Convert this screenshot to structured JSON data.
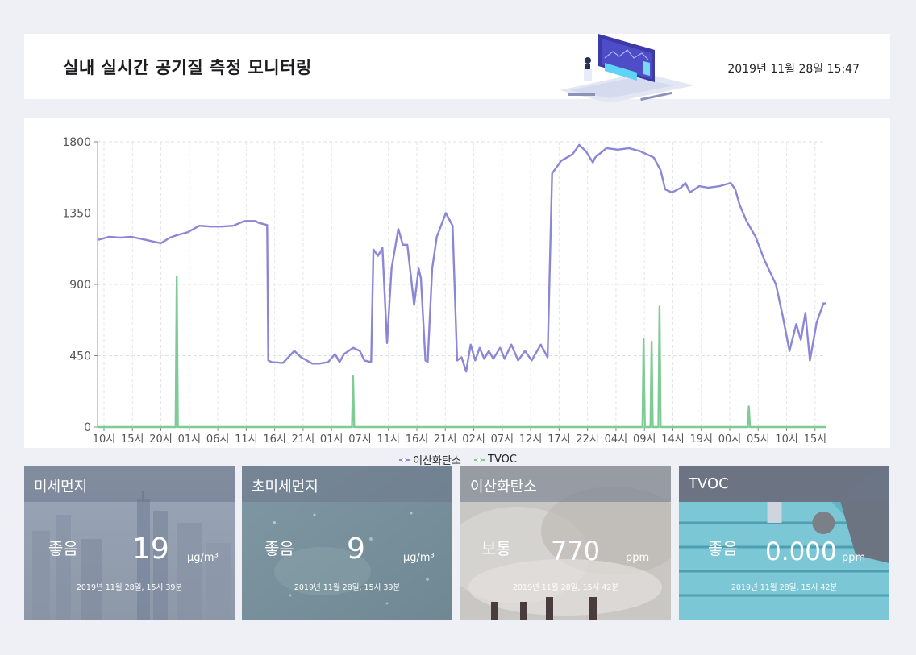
{
  "header": {
    "title": "실내 실시간 공기질 측정 모니터링",
    "datetime": "2019년 11월 28일 15:47"
  },
  "chart_data": {
    "type": "line",
    "ylim": [
      0,
      1800
    ],
    "yticks": [
      0,
      450,
      900,
      1350,
      1800
    ],
    "x_labels": [
      "10시",
      "15시",
      "20시",
      "01시",
      "06시",
      "11시",
      "16시",
      "21시",
      "01시",
      "07시",
      "11시",
      "16시",
      "21시",
      "02시",
      "07시",
      "12시",
      "17시",
      "22시",
      "04시",
      "09시",
      "14시",
      "19시",
      "00시",
      "05시",
      "10시",
      "15시"
    ],
    "x_range": [
      0,
      26
    ],
    "series": [
      {
        "name": "이산화탄소",
        "color": "#8b86d6",
        "points": [
          [
            0,
            1180
          ],
          [
            0.5,
            1200
          ],
          [
            1,
            1195
          ],
          [
            1.5,
            1200
          ],
          [
            2,
            1185
          ],
          [
            2.8,
            1160
          ],
          [
            3.2,
            1195
          ],
          [
            3.5,
            1210
          ],
          [
            4,
            1230
          ],
          [
            4.5,
            1270
          ],
          [
            5,
            1265
          ],
          [
            5.5,
            1265
          ],
          [
            6,
            1270
          ],
          [
            6.5,
            1300
          ],
          [
            7,
            1300
          ],
          [
            7.1,
            1290
          ],
          [
            7.5,
            1275
          ],
          [
            7.55,
            420
          ],
          [
            7.7,
            410
          ],
          [
            8.2,
            405
          ],
          [
            8.5,
            450
          ],
          [
            8.7,
            480
          ],
          [
            9,
            440
          ],
          [
            9.5,
            400
          ],
          [
            9.8,
            400
          ],
          [
            10.2,
            410
          ],
          [
            10.5,
            460
          ],
          [
            10.7,
            410
          ],
          [
            10.9,
            460
          ],
          [
            11.3,
            500
          ],
          [
            11.6,
            480
          ],
          [
            11.8,
            420
          ],
          [
            12.1,
            410
          ],
          [
            12.2,
            1120
          ],
          [
            12.4,
            1080
          ],
          [
            12.6,
            1130
          ],
          [
            12.8,
            530
          ],
          [
            13,
            1000
          ],
          [
            13.3,
            1250
          ],
          [
            13.5,
            1150
          ],
          [
            13.7,
            1150
          ],
          [
            14,
            770
          ],
          [
            14.2,
            1000
          ],
          [
            14.3,
            940
          ],
          [
            14.5,
            420
          ],
          [
            14.6,
            410
          ],
          [
            14.8,
            1000
          ],
          [
            15,
            1200
          ],
          [
            15.4,
            1350
          ],
          [
            15.7,
            1270
          ],
          [
            15.9,
            420
          ],
          [
            16.1,
            440
          ],
          [
            16.3,
            350
          ],
          [
            16.5,
            520
          ],
          [
            16.7,
            420
          ],
          [
            16.9,
            500
          ],
          [
            17.1,
            430
          ],
          [
            17.3,
            480
          ],
          [
            17.5,
            430
          ],
          [
            17.8,
            500
          ],
          [
            18,
            430
          ],
          [
            18.3,
            520
          ],
          [
            18.6,
            420
          ],
          [
            18.9,
            480
          ],
          [
            19.2,
            420
          ],
          [
            19.6,
            520
          ],
          [
            19.9,
            440
          ],
          [
            20.1,
            1600
          ],
          [
            20.5,
            1680
          ],
          [
            21,
            1720
          ],
          [
            21.3,
            1780
          ],
          [
            21.6,
            1740
          ],
          [
            21.9,
            1670
          ],
          [
            22,
            1700
          ],
          [
            22.5,
            1760
          ],
          [
            23,
            1750
          ],
          [
            23.5,
            1760
          ],
          [
            24,
            1740
          ],
          [
            24.3,
            1720
          ],
          [
            24.6,
            1700
          ],
          [
            24.9,
            1620
          ],
          [
            25.1,
            1500
          ],
          [
            25.4,
            1480
          ],
          [
            25.8,
            1510
          ],
          [
            26,
            1540
          ],
          [
            26.2,
            1480
          ],
          [
            26.6,
            1520
          ],
          [
            27,
            1510
          ],
          [
            27.5,
            1520
          ],
          [
            28,
            1540
          ],
          [
            28.2,
            1500
          ],
          [
            28.4,
            1400
          ],
          [
            28.7,
            1300
          ],
          [
            29.1,
            1200
          ],
          [
            29.5,
            1050
          ],
          [
            30,
            900
          ],
          [
            30.3,
            700
          ],
          [
            30.6,
            480
          ],
          [
            30.9,
            650
          ],
          [
            31.1,
            550
          ],
          [
            31.3,
            720
          ],
          [
            31.5,
            420
          ],
          [
            31.8,
            660
          ],
          [
            32.1,
            780
          ],
          [
            32.2,
            780
          ]
        ]
      },
      {
        "name": "TVOC",
        "color": "#7ecb95",
        "points": [
          [
            0,
            0
          ],
          [
            3.45,
            0
          ],
          [
            3.5,
            950
          ],
          [
            3.55,
            0
          ],
          [
            11.25,
            0
          ],
          [
            11.3,
            320
          ],
          [
            11.35,
            0
          ],
          [
            24.1,
            0
          ],
          [
            24.15,
            560
          ],
          [
            24.2,
            0
          ],
          [
            24.45,
            0
          ],
          [
            24.5,
            540
          ],
          [
            24.55,
            0
          ],
          [
            24.8,
            0
          ],
          [
            24.85,
            760
          ],
          [
            24.9,
            0
          ],
          [
            28.75,
            0
          ],
          [
            28.8,
            130
          ],
          [
            28.85,
            0
          ],
          [
            32.2,
            0
          ]
        ]
      }
    ],
    "legend_position": "bottom-center",
    "grid": true
  },
  "cards": [
    {
      "name": "미세먼지",
      "status": "좋음",
      "value": "19",
      "unit": "μg/m³",
      "time": "2019년 11월 28일, 15시 39분"
    },
    {
      "name": "초미세먼지",
      "status": "좋음",
      "value": "9",
      "unit": "μg/m³",
      "time": "2019년 11월 28일, 15시 39분"
    },
    {
      "name": "이산화탄소",
      "status": "보통",
      "value": "770",
      "unit": "ppm",
      "time": "2019년 11월 28일, 15시 42분"
    },
    {
      "name": "TVOC",
      "status": "좋음",
      "value": "0.000",
      "unit": "ppm",
      "time": "2019년 11월 28일, 15시 42분"
    }
  ]
}
